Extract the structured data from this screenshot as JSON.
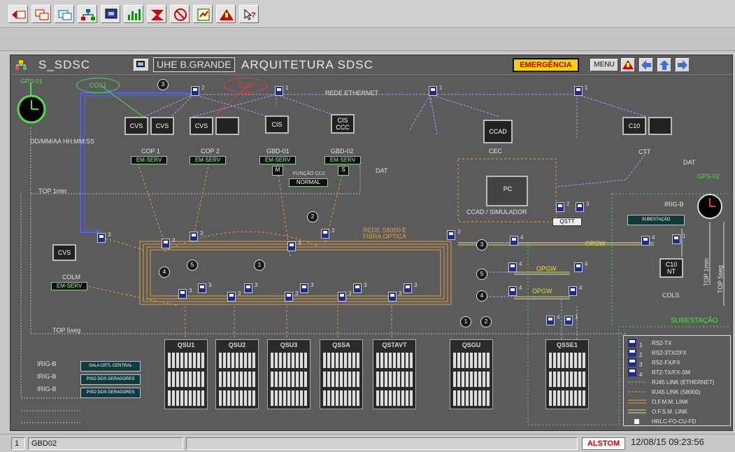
{
  "toolbar": {
    "buttons": [
      "back-icon",
      "windows-icon",
      "window-copy-icon",
      "network-icon",
      "monitor-icon",
      "bar-chart-icon",
      "alarm-icon",
      "mute-icon",
      "report-icon",
      "warning-icon",
      "help-icon"
    ]
  },
  "header": {
    "app_name": "S_SDSC",
    "station": "UHE B.GRANDE",
    "title": "ARQUITETURA SDSC",
    "emergency": "EMERGÊNCIA",
    "menu": "MENU"
  },
  "diagram": {
    "gps_left": "GPS-01",
    "gps_right": "GPS-02",
    "cos1": "COS1",
    "cos2": "COS2",
    "datetime_fmt": "DD/MM/AA HH:MM:SS",
    "ethernet": "REDE ETHERNET",
    "cvs": "CVS",
    "cis": "CIS",
    "cis_ccc": "CIS CCC",
    "cop1": "COP 1",
    "cop2": "COP 2",
    "gbd01": "GBD-01",
    "gbd02": "GBD-02",
    "em_serv": "EM-SERV",
    "m": "M",
    "s": "S",
    "funcao_ccc": "FUNÇÃO CCC",
    "normal": "NORMAL",
    "dat": "DAT",
    "cec": "CEC",
    "ccad": "CCAD",
    "pc": "PC",
    "ccad_sim": "CCAD / SIMULADOR",
    "c10": "C10",
    "ctt": "CTT",
    "qstt": "QSTT",
    "irig_b": "IRIG-B",
    "subestacao_box": "SUBESTAÇÃO",
    "top_1min": "TOP 1min",
    "top_1min_v": "TOP 1min",
    "top_5seg": "TOP 5seg",
    "top_5seg_v": "TOP 5seg",
    "rede_s8000": "REDE S8000-E",
    "fibra": "FIBRA OPTICA",
    "opgw": "OPGW",
    "colm": "COLM",
    "c10nt": "C10 NT",
    "cols": "COLS",
    "subestacao": "SUBESTAÇÃO",
    "irig_labels": [
      "IRIG-B",
      "IRIG-B",
      "IRIG-B"
    ],
    "teal_boxes": [
      "SALA CRTL CENTRAL",
      "PISO DOS GERADORES",
      "PISO DOS GERADORES"
    ],
    "racks": [
      "QSU1",
      "QSU2",
      "QSU3",
      "QSSA",
      "QSTAVT",
      "QSGU",
      "QSSE1"
    ],
    "circle_nums": [
      "3",
      "2",
      "4",
      "5",
      "1",
      "3",
      "5",
      "4",
      "1",
      "2"
    ],
    "switch_nums": [
      "2",
      "1",
      "1",
      "1",
      "3",
      "3",
      "3",
      "3",
      "3",
      "3",
      "3",
      "3",
      "3",
      "3",
      "3",
      "3",
      "3",
      "3",
      "3",
      "3",
      "4",
      "4",
      "4",
      "4",
      "4",
      "4",
      "4",
      "1",
      "1",
      "2",
      "3"
    ]
  },
  "legend": [
    {
      "num": "1",
      "text": "RS2-TX"
    },
    {
      "num": "2",
      "text": "RS2-3TX/2FX"
    },
    {
      "num": "3",
      "text": "RS2-FX/FX"
    },
    {
      "num": "4",
      "text": "RT2-TX/FX-SM"
    },
    {
      "num": "",
      "text": "RJ45 LINK (ETHERNET)"
    },
    {
      "num": "",
      "text": "RJ45 LINK (S8000)"
    },
    {
      "num": "",
      "text": "O.F.M.M. LINK"
    },
    {
      "num": "",
      "text": "O.F.S.M. LINK"
    },
    {
      "num": "",
      "text": "HRLC-FO-CU-FD"
    }
  ],
  "status": {
    "page": "1",
    "node": "GBD02",
    "brand": "ALSTOM",
    "clock": "12/08/15 09:23:56"
  },
  "colors": {
    "ethernet": "#9aa4ff",
    "s8000": "#e0a040",
    "green": "#4fe04f",
    "red": "#e04040",
    "emergency": "#f4d200"
  }
}
